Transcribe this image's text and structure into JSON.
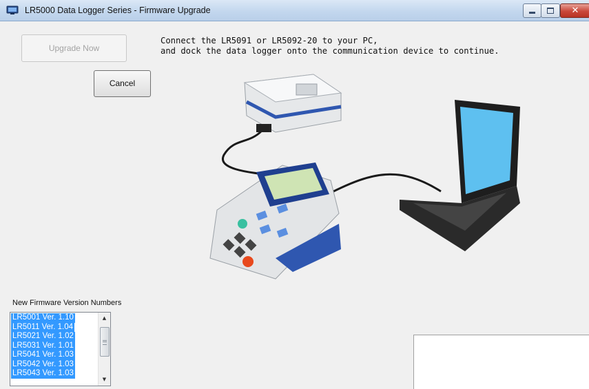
{
  "window": {
    "title": "LR5000 Data Logger Series - Firmware Upgrade",
    "app_icon": "monitor-icon",
    "controls": [
      "minimize-icon",
      "maximize-icon",
      "close-icon"
    ],
    "close_glyph": "✕"
  },
  "buttons": {
    "upgrade_now": "Upgrade Now",
    "upgrade_now_enabled": false,
    "cancel": "Cancel"
  },
  "instructions": {
    "line1": "Connect the LR5091 or LR5092-20 to your PC,",
    "line2": "and dock the data logger onto the communication device to continue."
  },
  "illustration": {
    "icons": [
      "communication-adapter-icon",
      "data-logger-icon",
      "laptop-icon",
      "usb-cable-icon"
    ]
  },
  "firmware": {
    "label": "New Firmware Version Numbers",
    "items": [
      "LR5001 Ver. 1.10",
      "LR5011 Ver. 1.04",
      "LR5021 Ver. 1.02",
      "LR5031 Ver. 1.01",
      "LR5041 Ver. 1.03",
      "LR5042 Ver. 1.03",
      "LR5043 Ver. 1.03"
    ],
    "scroll_up": "▲",
    "scroll_down": "▼"
  },
  "colors": {
    "selection": "#3399ff",
    "window_bg": "#f0f0f0",
    "titlebar": "#c3d7ee",
    "close_button": "#c9473a"
  }
}
